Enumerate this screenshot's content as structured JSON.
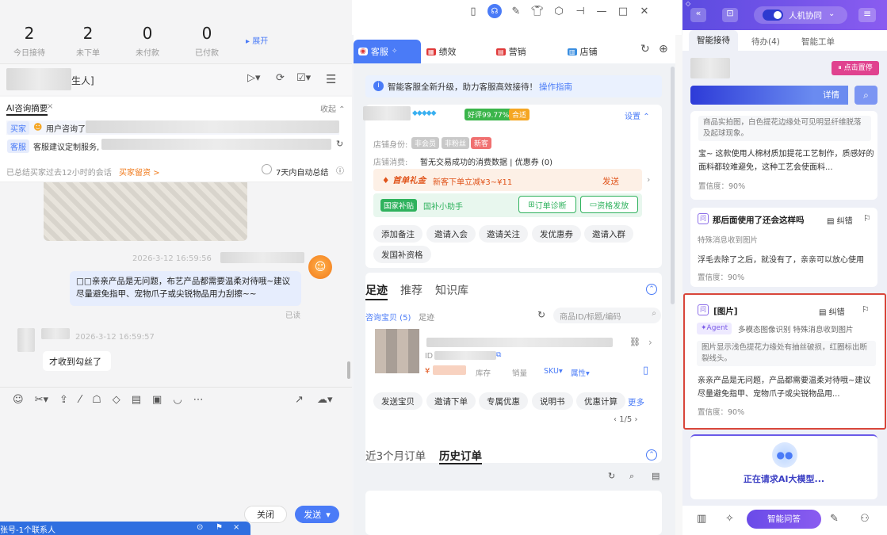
{
  "top_icons": [
    "phone-icon",
    "support-icon",
    "edit-icon",
    "shirt-icon",
    "settings-icon",
    "pin-icon",
    "minimize-icon",
    "maximize-icon",
    "close-icon"
  ],
  "stats": [
    {
      "num": "2",
      "label": "今日接待"
    },
    {
      "num": "2",
      "label": "未下单"
    },
    {
      "num": "0",
      "label": "未付款"
    },
    {
      "num": "0",
      "label": "已付款"
    }
  ],
  "expand_label": "展开",
  "chat_title_suffix": "生人]",
  "ai_summary": {
    "title": "AI咨询摘要",
    "collapse": "收起",
    "buyer_tag": "买家",
    "buyer_text": "用户咨询了",
    "service_tag": "客服",
    "service_text": "客服建议定制服务,",
    "history_text": "已总结买家过去12小时的会话",
    "leave_label": "买家留资 >",
    "auto_label": "7天内自动总结"
  },
  "messages": [
    {
      "time": "2026-3-12 16:59:56",
      "text": "□□亲亲产品是无问题，布艺产品都需要温柔对待哦~建议尽量避免指甲、宠物爪子或尖锐物品用力刮擦~~",
      "status": "已读"
    },
    {
      "time": "2026-3-12 16:59:57",
      "text": "才收到勾丝了"
    }
  ],
  "chat_buttons": {
    "close": "关闭",
    "send": "发送"
  },
  "bottom_bar": "张号-1个联系人",
  "tabs": [
    "客服",
    "绩效",
    "营销",
    "店铺"
  ],
  "notice": {
    "text": "智能客服全新升级，助力客服高效接待！",
    "link": "操作指南"
  },
  "customer": {
    "rating": "好评99.77%",
    "badge": "合适",
    "setting": "设置",
    "identity_label": "店铺身份:",
    "identity_tags": [
      "非会员",
      "非粉丝",
      "新客"
    ],
    "consume_label": "店铺消费:",
    "consume_text": "暂无交易成功的消费数据 | 优惠券 (0)"
  },
  "promo": {
    "title": "首单礼金",
    "text": "新客下单立减¥3~¥11",
    "send": "发送",
    "subsidy": "国家补贴",
    "subsidy_text": "国补小助手",
    "diag": "订单诊断",
    "qual": "资格发放"
  },
  "actions": [
    "添加备注",
    "邀请入会",
    "邀请关注",
    "发优惠券",
    "邀请入群",
    "发国补资格"
  ],
  "footprint": {
    "tabs": [
      "足迹",
      "推荐",
      "知识库"
    ],
    "sub": [
      "咨询宝贝 (5)",
      "足迹"
    ],
    "search_placeholder": "商品ID/标题/编码",
    "id_label": "ID",
    "stock": "库存",
    "sales": "销量",
    "sku": "SKU",
    "attr": "属性",
    "page": "1/5"
  },
  "product_actions": [
    "发送宝贝",
    "邀请下单",
    "专属优惠",
    "说明书",
    "优惠计算",
    "更多"
  ],
  "orders": {
    "tabs": [
      "近3个月订单",
      "历史订单"
    ]
  },
  "right": {
    "top_label": "人机协同",
    "tabs": [
      "智能接待",
      "待办(4)",
      "智能工单"
    ],
    "badge": "点击置停",
    "detail": "详情",
    "card1": {
      "text1": "商品实拍图，白色提花边缘处可见明显纤维脱落及起球现象。",
      "text2": "宝~ 这款使用人棉材质加提花工艺制作，质感好的面料都较难避免，这种工艺会使面料...",
      "conf": "置信度：90%"
    },
    "card2": {
      "title": "那后面使用了还会这样吗",
      "fix": "纠错",
      "desc": "特殊消息收到图片",
      "text": "浮毛去除了之后，就没有了，亲亲可以放心使用",
      "conf": "置信度：90%"
    },
    "card3": {
      "title": "[图片]",
      "fix": "纠错",
      "agent": "Agent",
      "agent_text": "多模态图像识别 特殊消息收到图片",
      "quote": "图片显示浅色提花力缘处有抽丝破损，红圈标出断裂线头。",
      "reply": "亲亲产品是无问题，产品都需要温柔对待哦~建议尽量避免指甲、宠物爪子或尖锐物品用...",
      "conf": "置信度：90%"
    },
    "loading": "正在请求AI大模型...",
    "smart_btn": "智能问答"
  },
  "accent": "#4a7bf7"
}
